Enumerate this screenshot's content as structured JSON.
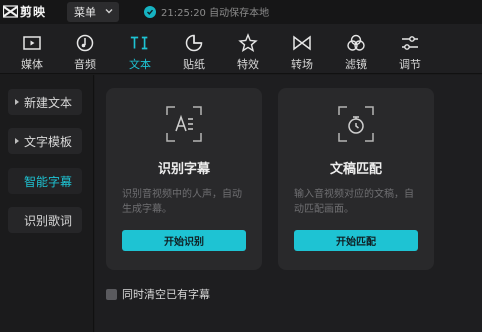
{
  "app": {
    "name": "剪映"
  },
  "titlebar": {
    "menu_label": "菜单",
    "autosave_text": "21:25:20 自动保存本地"
  },
  "tabs": [
    {
      "label": "媒体",
      "icon": "media-icon"
    },
    {
      "label": "音频",
      "icon": "audio-icon"
    },
    {
      "label": "文本",
      "icon": "text-icon",
      "active": true
    },
    {
      "label": "贴纸",
      "icon": "sticker-icon"
    },
    {
      "label": "特效",
      "icon": "effects-icon"
    },
    {
      "label": "转场",
      "icon": "transition-icon"
    },
    {
      "label": "滤镜",
      "icon": "filter-icon"
    },
    {
      "label": "调节",
      "icon": "adjust-icon"
    }
  ],
  "sidebar": {
    "items": [
      {
        "label": "新建文本"
      },
      {
        "label": "文字模板"
      },
      {
        "label": "智能字幕",
        "active": true
      },
      {
        "label": "识别歌词"
      }
    ]
  },
  "cards": [
    {
      "title": "识别字幕",
      "desc": "识别音视频中的人声，自动生成字幕。",
      "button": "开始识别",
      "icon": "subtitle-recognize-icon"
    },
    {
      "title": "文稿匹配",
      "desc": "输入音视频对应的文稿，自动匹配画面。",
      "button": "开始匹配",
      "icon": "script-match-icon"
    }
  ],
  "options": {
    "clear_existing_label": "同时清空已有字幕",
    "clear_existing_checked": false
  },
  "colors": {
    "accent": "#1ec3d3",
    "background": "#1b1b1c",
    "card": "#29292b"
  }
}
